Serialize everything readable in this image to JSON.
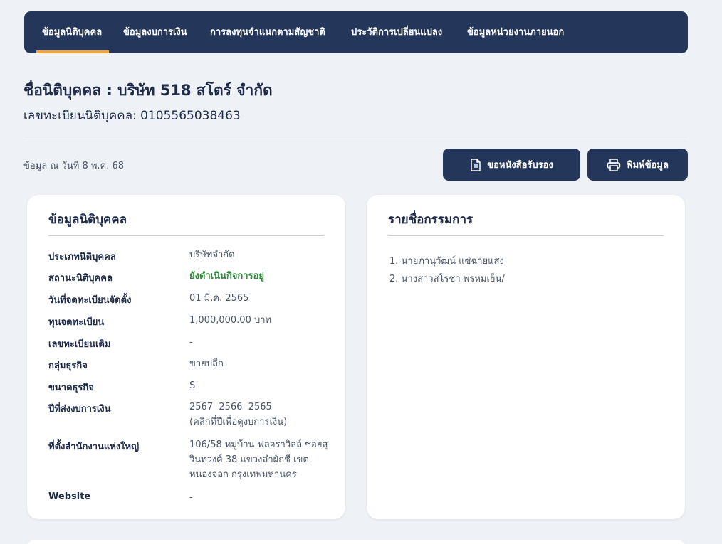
{
  "nav": {
    "tabs": [
      {
        "label": "ข้อมูลนิติบุคคล",
        "active": true
      },
      {
        "label": "ข้อมูลงบการเงิน",
        "active": false
      },
      {
        "label": "การลงทุนจำแนกตามสัญชาติ",
        "active": false
      },
      {
        "label": "ประวัติการเปลี่ยนแปลง",
        "active": false
      },
      {
        "label": "ข้อมูลหน่วยงานภายนอก",
        "active": false
      }
    ]
  },
  "header": {
    "company_name": "ชื่อนิติบุคคล : บริษัท 518 สโตร์ จำกัด",
    "registration_no": "เลขทะเบียนนิติบุคคล: 0105565038463",
    "as_of": "ข้อมูล ณ วันที่ 8 พ.ค. 68"
  },
  "actions": {
    "request_certificate": "ขอหนังสือรับรอง",
    "print": "พิมพ์ข้อมูล"
  },
  "company_info": {
    "title": "ข้อมูลนิติบุคคล",
    "rows": [
      {
        "label": "ประเภทนิติบุคคล",
        "value": "บริษัทจำกัด"
      },
      {
        "label": "สถานะนิติบุคคล",
        "value": "ยังดำเนินกิจการอยู่"
      },
      {
        "label": "วันที่จดทะเบียนจัดตั้ง",
        "value": "01 มี.ค. 2565"
      },
      {
        "label": "ทุนจดทะเบียน",
        "value": "1,000,000.00 บาท"
      },
      {
        "label": "เลขทะเบียนเดิม",
        "value": "-"
      },
      {
        "label": "กลุ่มธุรกิจ",
        "value": "ขายปลีก"
      },
      {
        "label": "ขนาดธุรกิจ",
        "value": "S"
      },
      {
        "label": "ปีที่ส่งงบการเงิน",
        "value": "2567  2566  2565",
        "sub": "(คลิกที่ปีเพื่อดูงบการเงิน)"
      },
      {
        "label": "ที่ตั้งสำนักงานแห่งใหญ่",
        "value": "106/58 หมู่บ้าน ฟลอราวิลล์ ซอยสุวินทวงศ์ 38 แขวงลำผักชี เขตหนองจอก กรุงเทพมหานคร"
      },
      {
        "label": "Website",
        "value": "-"
      }
    ],
    "status_color": "#2f8a3a"
  },
  "directors": {
    "title": "รายชื่อกรรมการ",
    "items": [
      "1. นายภานุวัฒน์ แซ่ฉายแสง",
      "2. นางสาวสโรชา พรหมเย็น/"
    ]
  },
  "colors": {
    "nav_bg": "#243659",
    "nav_active_underline": "#f2a33a",
    "page_bg": "#eef1f5"
  }
}
